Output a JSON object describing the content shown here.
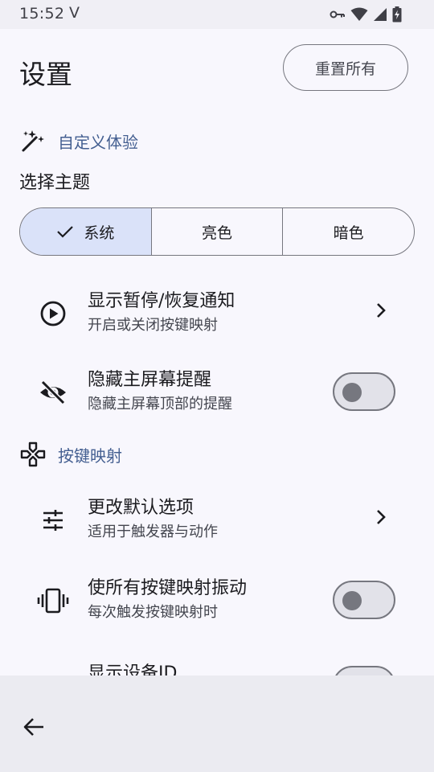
{
  "status_bar": {
    "time": "15:52",
    "carrier_icon": "V"
  },
  "header": {
    "title": "设置",
    "reset_label": "重置所有"
  },
  "sections": {
    "experience": {
      "label": "自定义体验",
      "icon": "auto-fix-wand-icon"
    },
    "keymaps": {
      "label": "按键映射",
      "icon": "gamepad-icon"
    }
  },
  "theme": {
    "label": "选择主题",
    "options": [
      "系统",
      "亮色",
      "暗色"
    ],
    "selected": "系统"
  },
  "items": [
    {
      "title": "显示暂停/恢复通知",
      "subtitle": "开启或关闭按键映射",
      "control": "chevron",
      "icon": "play-circle-icon"
    },
    {
      "title": "隐藏主屏幕提醒",
      "subtitle": "隐藏主屏幕顶部的提醒",
      "control": "switch",
      "checked": false,
      "icon": "eye-off-icon"
    },
    {
      "title": "更改默认选项",
      "subtitle": "适用于触发器与动作",
      "control": "chevron",
      "icon": "tune-icon"
    },
    {
      "title": "使所有按键映射振动",
      "subtitle": "每次触发按键映射时",
      "control": "switch",
      "checked": false,
      "icon": "vibrate-icon"
    },
    {
      "title": "显示设备ID",
      "subtitle": "",
      "control": "switch",
      "checked": false
    }
  ],
  "colors": {
    "accent": "#445f91",
    "selected_segment": "#dae2f9",
    "background": "#f8f7fd"
  }
}
